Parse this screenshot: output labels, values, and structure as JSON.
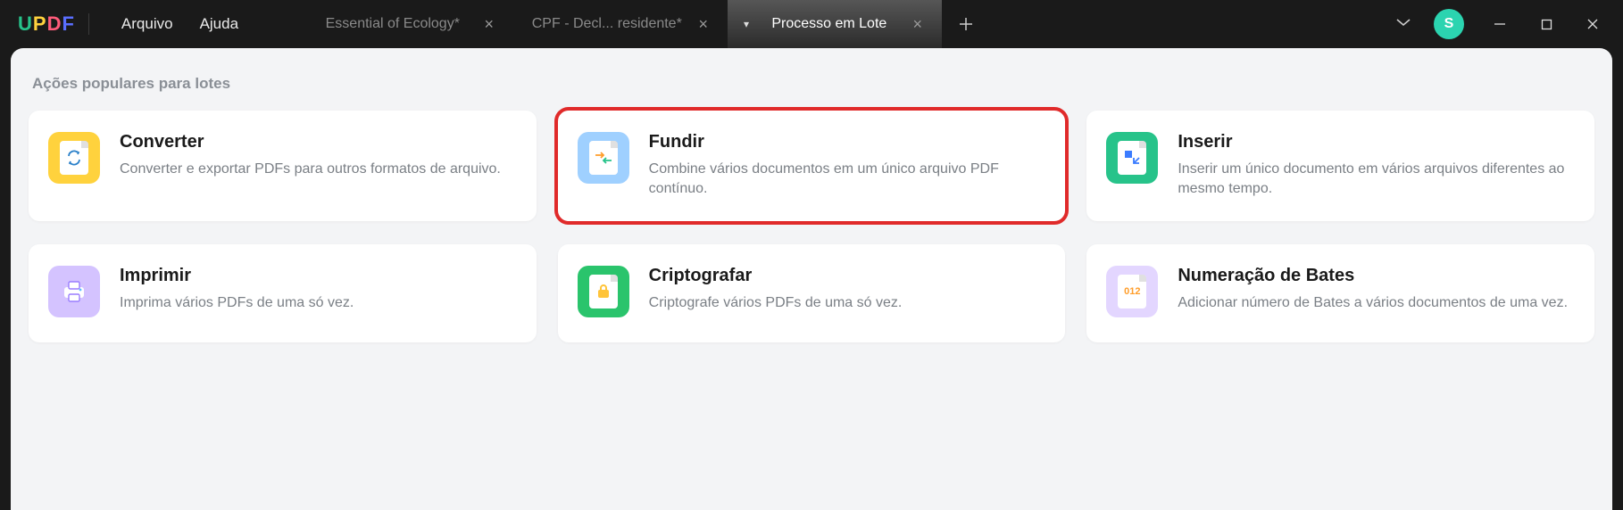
{
  "menu": {
    "file": "Arquivo",
    "help": "Ajuda"
  },
  "tabs": [
    {
      "label": "Essential of Ecology*",
      "active": false
    },
    {
      "label": "CPF - Decl... residente*",
      "active": false
    },
    {
      "label": "Processo em Lote",
      "active": true
    }
  ],
  "avatar_initial": "S",
  "section_title": "Ações populares para lotes",
  "cards": {
    "convert": {
      "title": "Converter",
      "desc": "Converter e exportar PDFs para outros formatos de arquivo."
    },
    "merge": {
      "title": "Fundir",
      "desc": "Combine vários documentos em um único arquivo PDF contínuo."
    },
    "insert": {
      "title": "Inserir",
      "desc": "Inserir um único documento em vários arquivos diferentes ao mesmo tempo."
    },
    "print": {
      "title": "Imprimir",
      "desc": "Imprima vários PDFs de uma só vez."
    },
    "encrypt": {
      "title": "Criptografar",
      "desc": "Criptografe vários PDFs de uma só vez."
    },
    "bates": {
      "title": "Numeração de Bates",
      "desc": "Adicionar número de Bates a vários documentos de uma vez."
    }
  }
}
